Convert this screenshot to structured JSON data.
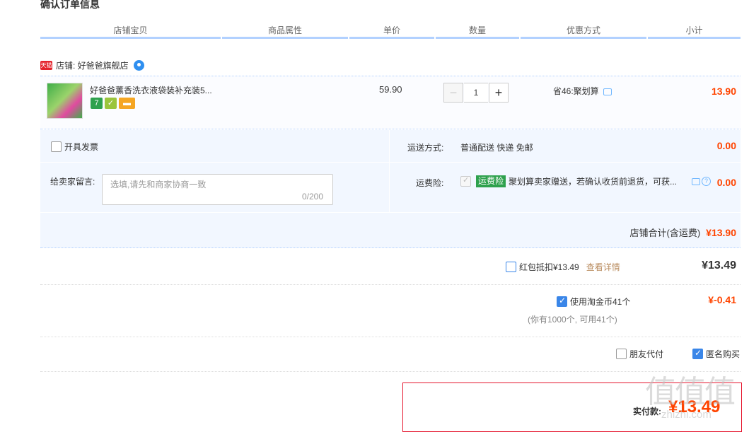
{
  "section_title": "确认订单信息",
  "columns": [
    "店铺宝贝",
    "商品属性",
    "单价",
    "数量",
    "优惠方式",
    "小计"
  ],
  "shop": {
    "tmall_tag": "天猫",
    "label": "店铺: 好爸爸旗舰店"
  },
  "item": {
    "name": "好爸爸薰香洗衣液袋装补充装5...",
    "badge_7": "7",
    "price": "59.90",
    "quantity": "1",
    "minus": "−",
    "plus": "+",
    "promotion": "省46:聚划算",
    "subtotal": "13.90"
  },
  "invoice": {
    "label": "开具发票"
  },
  "shipping": {
    "label": "运送方式:",
    "value": "普通配送 快递 免邮",
    "price": "0.00"
  },
  "message": {
    "label": "给卖家留言:",
    "placeholder": "选填,请先和商家协商一致",
    "count": "0/200"
  },
  "insurance": {
    "label": "运费险:",
    "tag": "运费险",
    "text": "聚划算卖家赠送，若确认收货前退货，可获...",
    "help": "?",
    "price": "0.00"
  },
  "shop_total": {
    "label": "店铺合计(含运费)",
    "value": "¥13.90"
  },
  "hongbao": {
    "label": "红包抵扣¥13.49",
    "link": "查看详情",
    "amount": "¥13.49"
  },
  "taojinbi": {
    "label": "使用淘金币41个",
    "amount": "¥-0.41",
    "sub": "(你有1000个, 可用41个)"
  },
  "friend_pay": {
    "label": "朋友代付"
  },
  "anonymous": {
    "label": "匿名购买"
  },
  "pay": {
    "label": "实付款:",
    "amount": "¥13.49"
  },
  "watermark": {
    "big": "值值值",
    "small": "zhizhi.com"
  },
  "colors": {
    "price_red": "#ff4400",
    "header_border": "#b2d1ff",
    "option_bg": "#f2f7ff",
    "checkbox_blue": "#3a86e8"
  }
}
